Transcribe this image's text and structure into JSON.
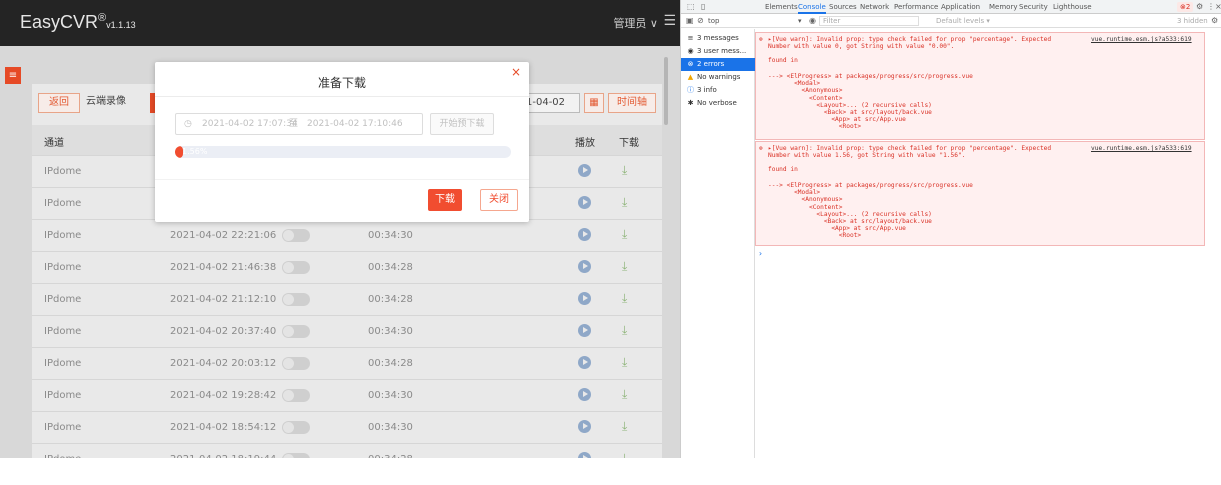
{
  "app": {
    "logo": "EasyCVR",
    "logo_reg": "®",
    "version": "v1.1.13",
    "user": "管理员 ∨",
    "menu_icon": "menu-icon"
  },
  "toolbar": {
    "back_label": "返回",
    "cloud_label": "云端录像",
    "date_partial": "1-04-02",
    "timeline_label": "时间轴"
  },
  "table": {
    "headers": {
      "channel": "通道",
      "play": "播放",
      "download": "下载"
    },
    "rows": [
      {
        "name": "IPdome",
        "time": "",
        "duration": ""
      },
      {
        "name": "IPdome",
        "time": "",
        "duration": ""
      },
      {
        "name": "IPdome",
        "time": "2021-04-02 22:21:06",
        "duration": "00:34:30"
      },
      {
        "name": "IPdome",
        "time": "2021-04-02 21:46:38",
        "duration": "00:34:28"
      },
      {
        "name": "IPdome",
        "time": "2021-04-02 21:12:10",
        "duration": "00:34:28"
      },
      {
        "name": "IPdome",
        "time": "2021-04-02 20:37:40",
        "duration": "00:34:30"
      },
      {
        "name": "IPdome",
        "time": "2021-04-02 20:03:12",
        "duration": "00:34:28"
      },
      {
        "name": "IPdome",
        "time": "2021-04-02 19:28:42",
        "duration": "00:34:30"
      },
      {
        "name": "IPdome",
        "time": "2021-04-02 18:54:12",
        "duration": "00:34:30"
      },
      {
        "name": "IPdome",
        "time": "2021-04-02 18:19:44",
        "duration": "00:34:28"
      }
    ]
  },
  "modal": {
    "title": "准备下载",
    "close": "×",
    "range_start": "2021-04-02 17:07:34",
    "range_sep": "至",
    "range_end": "2021-04-02 17:10:46",
    "predownload_label": "开始预下载",
    "progress_percent": 1.56,
    "progress_text": "1.56%",
    "download_label": "下载",
    "close_label": "关闭"
  },
  "devtools": {
    "tabs": [
      "Elements",
      "Console",
      "Sources",
      "Network",
      "Performance",
      "Application",
      "Memory",
      "Security",
      "Lighthouse"
    ],
    "active_tab": "Console",
    "error_count": "2",
    "context": "top",
    "filter_placeholder": "Filter",
    "levels": "Default levels ▾",
    "hidden": "3 hidden",
    "sidebar": [
      {
        "label": "3 messages",
        "icon": "list-icon"
      },
      {
        "label": "3 user mess...",
        "icon": "user-icon"
      },
      {
        "label": "2 errors",
        "icon": "error-icon"
      },
      {
        "label": "No warnings",
        "icon": "warning-icon"
      },
      {
        "label": "3 info",
        "icon": "info-icon"
      },
      {
        "label": "No verbose",
        "icon": "verbose-icon"
      }
    ],
    "messages": [
      {
        "text": "▸[Vue warn]: Invalid prop: type check failed for prop \"percentage\". Expected Number with value 0, got String with value \"0.00\".",
        "source": "vue.runtime.esm.js?a533:619",
        "found": "found in",
        "trace": "---> <ElProgress> at packages/progress/src/progress.vue\n       <Modal>\n         <Anonymous>\n           <Content>\n             <Layout>... (2 recursive calls)\n               <Back> at src/layout/back.vue\n                 <App> at src/App.vue\n                   <Root>"
      },
      {
        "text": "▸[Vue warn]: Invalid prop: type check failed for prop \"percentage\". Expected Number with value 1.56, got String with value \"1.56\".",
        "source": "vue.runtime.esm.js?a533:619",
        "found": "found in",
        "trace": "---> <ElProgress> at packages/progress/src/progress.vue\n       <Modal>\n         <Anonymous>\n           <Content>\n             <Layout>... (2 recursive calls)\n               <Back> at src/layout/back.vue\n                 <App> at src/App.vue\n                   <Root>"
      }
    ],
    "prompt": "›"
  }
}
